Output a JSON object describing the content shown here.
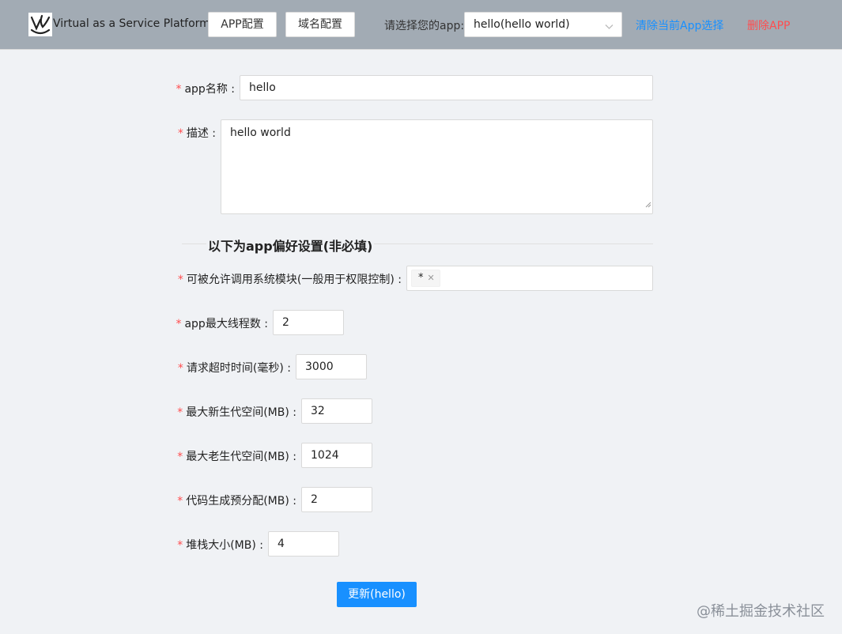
{
  "header": {
    "app_title": "Virtual as a Service Platform",
    "app_config_button": "APP配置",
    "domain_config_button": "域名配置",
    "select_label": "请选择您的app:",
    "selected_app": "hello(hello world)",
    "clear_selection_link": "清除当前App选择",
    "delete_app_link": "删除APP"
  },
  "form": {
    "app_name_label": "app名称 :",
    "app_name_value": "hello",
    "description_label": "描述 :",
    "description_value": "hello world",
    "preferences_heading": "以下为app偏好设置(非必填)",
    "modules_label": "可被允许调用系统模块(一般用于权限控制) :",
    "modules_tags": [
      "*"
    ],
    "max_threads_label": "app最大线程数 :",
    "max_threads_value": "2",
    "timeout_label": "请求超时时间(毫秒) :",
    "timeout_value": "3000",
    "new_space_label": "最大新生代空间(MB) :",
    "new_space_value": "32",
    "old_space_label": "最大老生代空间(MB) :",
    "old_space_value": "1024",
    "codegen_label": "代码生成预分配(MB) :",
    "codegen_value": "2",
    "stack_label": "堆栈大小(MB) :",
    "stack_value": "4",
    "required_mark": "*",
    "submit_button": "更新(hello)"
  },
  "watermark": "@稀土掘金技术社区",
  "colors": {
    "header_bg": "#a2abb4",
    "page_bg": "#f0f2f5",
    "primary": "#1890ff",
    "danger": "#ff4d4f"
  },
  "icons": [
    "logo-icon",
    "chevron-down-icon",
    "close-icon",
    "resize-handle-icon"
  ]
}
